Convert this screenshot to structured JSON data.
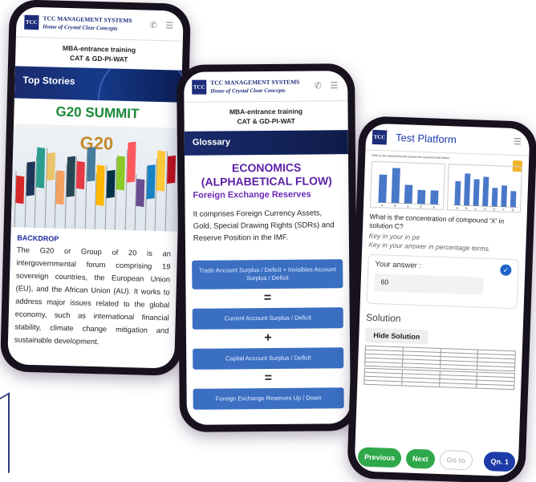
{
  "brand": {
    "line1": "TCC Management Systems",
    "line2": "Home of Crystal Clear Concepts",
    "logo_text": "TCC"
  },
  "subheader": {
    "line1": "MBA-entrance training",
    "line2": "CAT  &  GD-PI-WAT"
  },
  "phone1": {
    "hero": "Top Stories",
    "title": "G20 SUMMIT",
    "logo_text": "G20",
    "section": "BACKDROP",
    "body": "The G20 or Group of 20 is an intergovernmental forum comprising 19 sovereign countries, the European Union (EU), and the African Union (AU). It works to address major issues related to the global economy, such as international financial stability, climate change mitigation and sustainable development."
  },
  "phone2": {
    "hero": "Glossary",
    "heading": "ECONOMICS (ALPHABETICAL FLOW)",
    "subheading": "Foreign Exchange Reserves",
    "definition": "It comprises Foreign Currency Assets, Gold, Special Drawing Rights (SDRs) and Reserve Position in the IMF.",
    "box1": "Trade Account Surplus / Deficit  +  Invisibles Account Surplus / Deficit",
    "op1": "=",
    "box2": "Current Account Surplus / Deficit",
    "op2": "+",
    "box3": "Capital Account Surplus / Deficit",
    "op3": "=",
    "box4": "Foreign Exchange Reserves Up / Down"
  },
  "phone3": {
    "title": "Test Platform",
    "instructions": "Refer to the data below and answer the questions that follow.",
    "question": "What is the concentration of compound 'X' in solution C?",
    "input_placeholder": "Key in your in pe",
    "hint": "Key in your answer in percentage terms.",
    "answer_label": "Your answer :",
    "answer_value": "60",
    "solution_heading": "Solution",
    "hide_button": "Hide Solution",
    "prev_button": "Previous",
    "next_button": "Next",
    "goto_button": "Go to",
    "qn_button": "Qn. 1"
  },
  "chart_data": [
    {
      "type": "bar",
      "categories": [
        "A",
        "B",
        "C",
        "D",
        "E"
      ],
      "values": [
        60,
        75,
        40,
        30,
        30
      ],
      "ylim": [
        0,
        80
      ],
      "xlabel": "",
      "ylabel": ""
    },
    {
      "type": "bar",
      "categories": [
        "A",
        "B",
        "C",
        "D",
        "E",
        "F",
        "G"
      ],
      "values": [
        45,
        60,
        50,
        55,
        35,
        40,
        30
      ],
      "ylim": [
        0,
        70
      ],
      "xlabel": "",
      "ylabel": ""
    }
  ],
  "colors": {
    "brand_blue": "#1c2b7a",
    "glossary_purple": "#5b1fa6",
    "flow_box_blue": "#3a6fc2",
    "green_button": "#2ea84a",
    "g20_green": "#1a8a3a"
  }
}
